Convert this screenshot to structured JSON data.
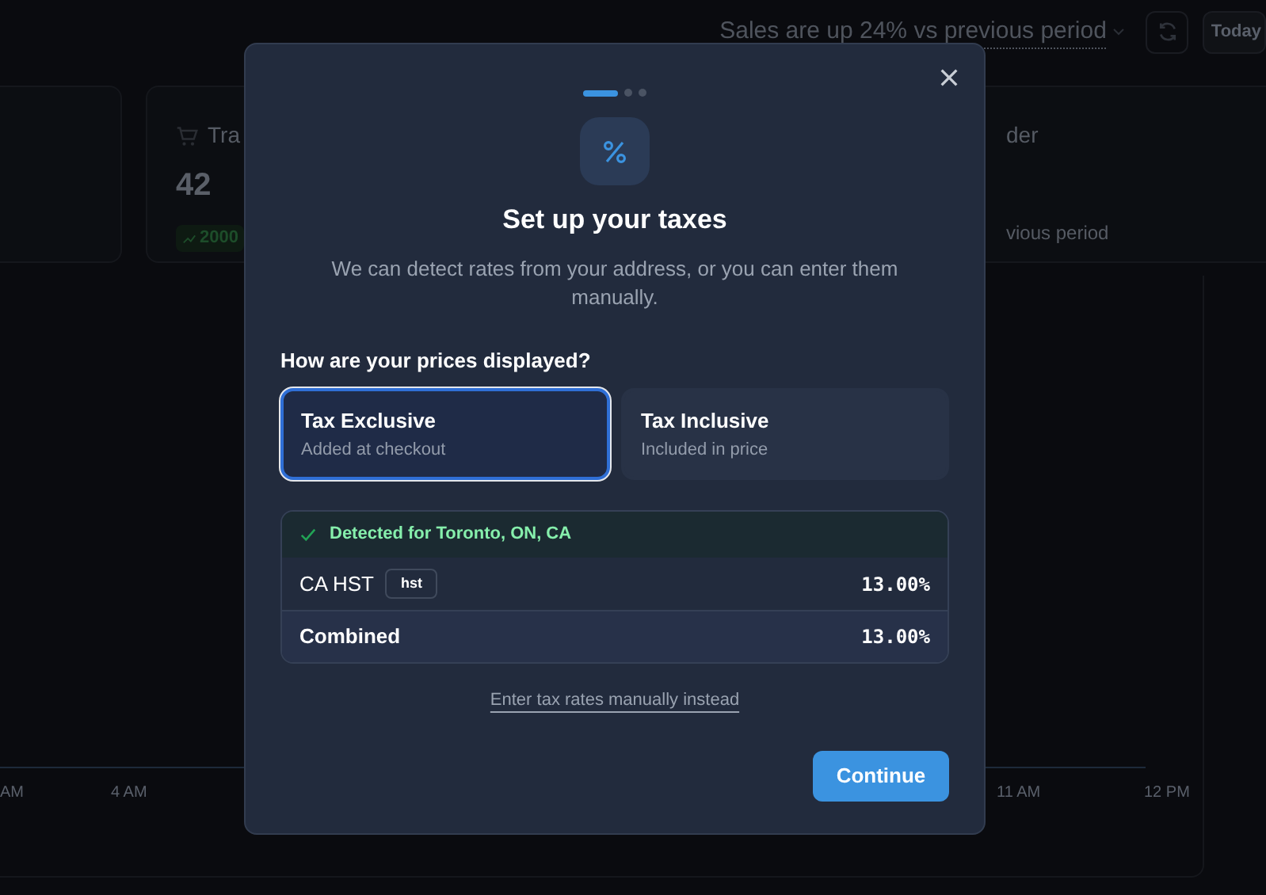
{
  "background": {
    "insight": "Sales are up 24% vs previous period",
    "date_button": "Today",
    "cards": [
      {
        "title": "Tra",
        "value": "42",
        "trend": "2000"
      },
      {
        "title": "der",
        "note": "vious period"
      }
    ],
    "chart_axis": [
      "AM",
      "4 AM",
      "11 AM",
      "12 PM"
    ]
  },
  "modal": {
    "steps": [
      {
        "selected": true
      },
      {
        "selected": false
      },
      {
        "selected": false
      }
    ],
    "title": "Set up your taxes",
    "description": "We can detect rates from your address, or you can enter them manually.",
    "question": "How are your prices displayed?",
    "options": [
      {
        "label": "Tax Exclusive",
        "hint": "Added at checkout",
        "selected": true
      },
      {
        "label": "Tax Inclusive",
        "hint": "Included in price",
        "selected": false
      }
    ],
    "detected": "Detected for Toronto, ON, CA",
    "rates": [
      {
        "kind": "rate",
        "name": "CA HST",
        "badge": "hst",
        "value": "13.00%"
      },
      {
        "kind": "total",
        "name": "Combined",
        "value": "13.00%"
      }
    ],
    "manual_link": "Enter tax rates manually instead",
    "primary_button": "Continue"
  }
}
